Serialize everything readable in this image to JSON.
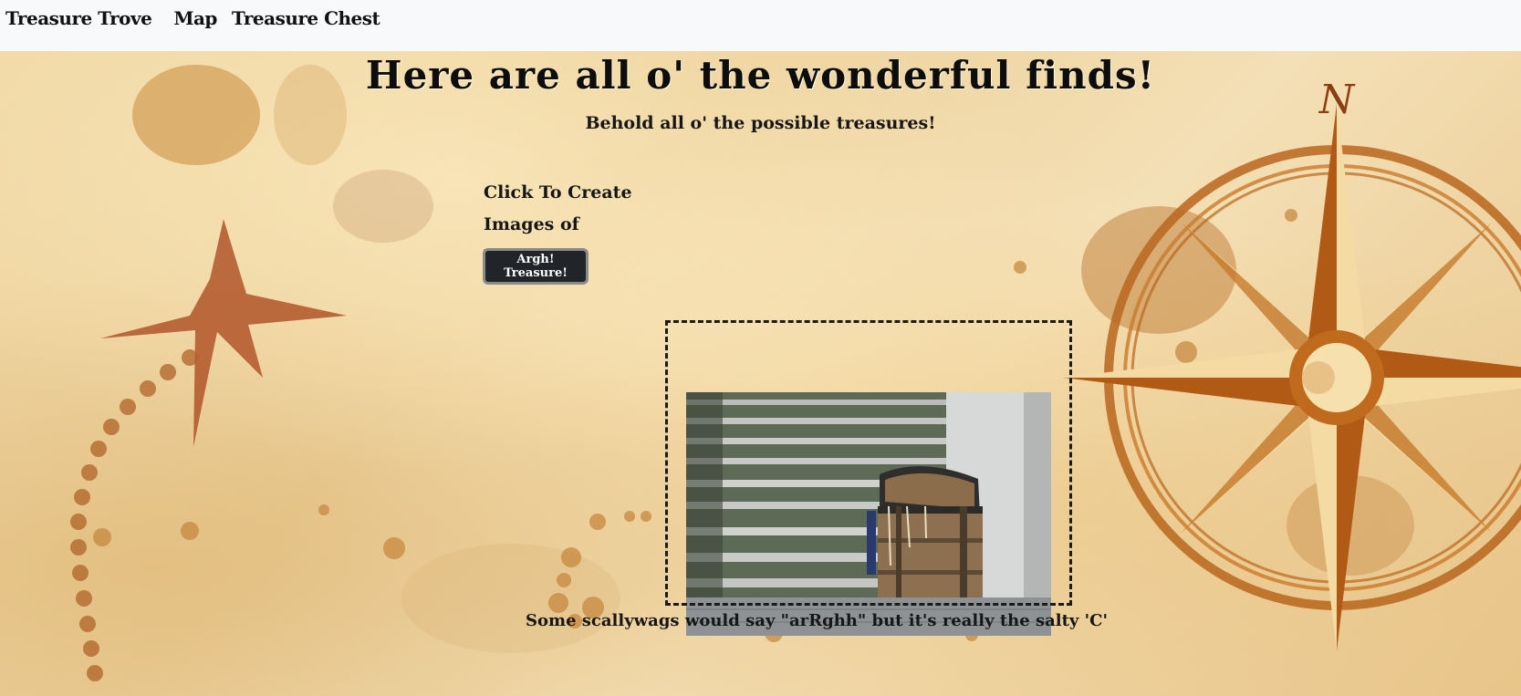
{
  "navbar": {
    "brand": "Treasure Trove",
    "links": [
      "Map",
      "Treasure Chest"
    ]
  },
  "main": {
    "title": "Here are all o' the wonderful finds!",
    "subtitle": "Behold all o' the possible treasures!",
    "create_label": "Click To Create Images of Treasure",
    "button_label": "Argh! Treasure!",
    "caption": "Some scallywags would say \"arRghh\" but it's really the salty 'C'"
  },
  "colors": {
    "parchment": "#f1d9a6",
    "ink": "#0d0d0d",
    "button_bg": "#212529",
    "navbar_bg": "#f8f9fa",
    "compass_rust": "#b8661d"
  },
  "icons": {
    "compass": "compass-rose-icon",
    "x_mark": "x-marks-the-spot-icon"
  }
}
